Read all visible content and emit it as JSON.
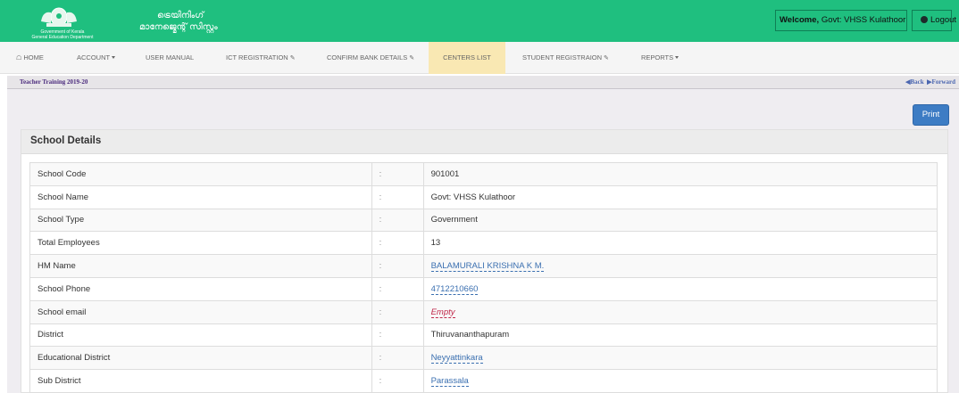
{
  "header": {
    "logo_line1": "Government of Kerala",
    "logo_line2": "General Education Department",
    "app_title_line1": "ട്രെയിനിംഗ്",
    "app_title_line2": "മാനേജ്മെന്റ് സിസ്റ്റം",
    "welcome_label": "Welcome,",
    "welcome_user": "Govt: VHSS Kulathoor",
    "logout_label": "Logout"
  },
  "nav": {
    "home": "HOME",
    "account": "ACCOUNT",
    "user_manual": "USER MANUAL",
    "ict_registration": "ICT REGISTRATION",
    "confirm_bank_details": "CONFIRM BANK DETAILS",
    "centers_list": "CENTERS LIST",
    "student_registration": "STUDENT REGISTRAION",
    "reports": "REPORTS",
    "active": "centers_list"
  },
  "breadcrumb": {
    "title": "Teacher Training 2019-20",
    "back": "Back",
    "forward": "Forward"
  },
  "print_label": "Print",
  "panel_title": "School Details",
  "separator": ":",
  "rows": [
    {
      "label": "School Code",
      "value": "901001"
    },
    {
      "label": "School Name",
      "value": "Govt: VHSS Kulathoor"
    },
    {
      "label": "School Type",
      "value": "Government"
    },
    {
      "label": "Total Employees",
      "value": "13"
    },
    {
      "label": "HM Name",
      "value": "BALAMURALI KRISHNA K M."
    },
    {
      "label": "School Phone",
      "value": "4712210660"
    },
    {
      "label": "School email",
      "value": "Empty"
    },
    {
      "label": "District",
      "value": "Thiruvananthapuram"
    },
    {
      "label": "Educational District",
      "value": "Neyyattinkara"
    },
    {
      "label": "Sub District",
      "value": "Parassala"
    }
  ],
  "colors": {
    "header_bg": "#1fbf7f",
    "active_nav_bg": "#f9e8b3",
    "print_button": "#3d7cc4",
    "link": "#3a6fb0",
    "empty": "#c0284a"
  }
}
